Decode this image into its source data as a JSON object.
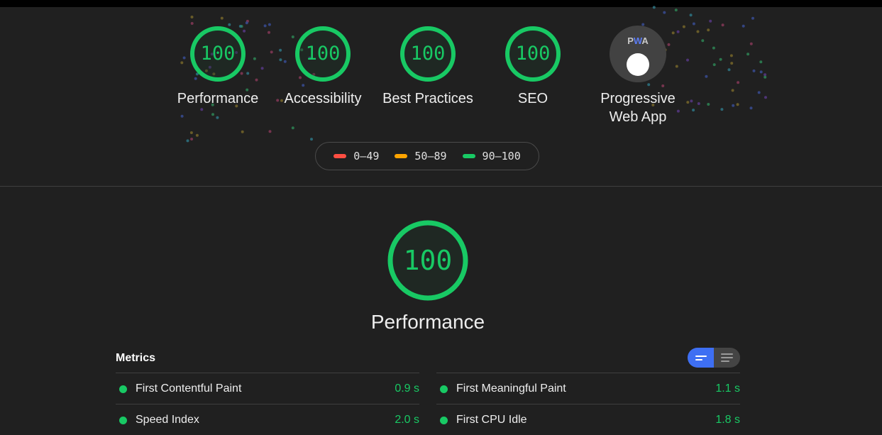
{
  "colors": {
    "pass": "#18c964",
    "average": "#ffa400",
    "fail": "#ff4e42",
    "toggle_active": "#3e6ff3"
  },
  "categories": [
    {
      "score": "100",
      "label": "Performance"
    },
    {
      "score": "100",
      "label": "Accessibility"
    },
    {
      "score": "100",
      "label": "Best Practices"
    },
    {
      "score": "100",
      "label": "SEO"
    }
  ],
  "pwa": {
    "badge_text_p": "P",
    "badge_text_w": "W",
    "badge_text_a": "A",
    "label_line1": "Progressive",
    "label_line2": "Web App",
    "icon": "pwa-badge-icon"
  },
  "legend": [
    {
      "range": "0–49",
      "color": "#ff4e42"
    },
    {
      "range": "50–89",
      "color": "#ffa400"
    },
    {
      "range": "90–100",
      "color": "#18c964"
    }
  ],
  "performance_section": {
    "score": "100",
    "title": "Performance",
    "metrics_heading": "Metrics",
    "view_toggle": {
      "selected": "compact-view-icon",
      "other": "expanded-view-icon"
    }
  },
  "metrics": {
    "left": [
      {
        "name": "First Contentful Paint",
        "value": "0.9 s"
      },
      {
        "name": "Speed Index",
        "value": "2.0 s"
      }
    ],
    "right": [
      {
        "name": "First Meaningful Paint",
        "value": "1.1 s"
      },
      {
        "name": "First CPU Idle",
        "value": "1.8 s"
      }
    ]
  }
}
